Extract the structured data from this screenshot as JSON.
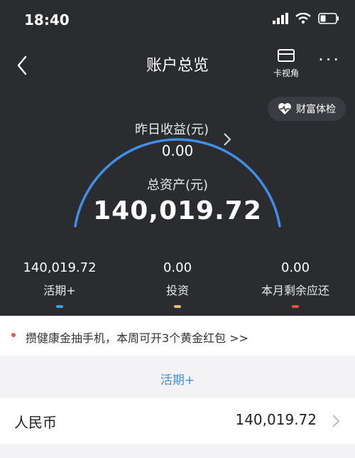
{
  "status": {
    "time": "18:40"
  },
  "nav": {
    "title": "账户总览",
    "card_view_label": "卡视角",
    "more_label": "···"
  },
  "health_check": {
    "label": "财富体检"
  },
  "yesterday_earnings": {
    "label": "昨日收益(元)",
    "value": "0.00"
  },
  "total_assets": {
    "label": "总资产(元)",
    "value": "140,019.72"
  },
  "stats": [
    {
      "value": "140,019.72",
      "label": "活期+",
      "color": "#3aa0e8"
    },
    {
      "value": "0.00",
      "label": "投资",
      "color": "#e3b97f"
    },
    {
      "value": "0.00",
      "label": "本月剩余应还",
      "color": "#e8503a"
    }
  ],
  "promo": {
    "text": "攒健康金抽手机，本周可开3个黄金红包 >>"
  },
  "section": {
    "title": "活期+"
  },
  "currency_row": {
    "label": "人民币",
    "value": "140,019.72"
  },
  "colors": {
    "accent": "#3e8fe6",
    "dark_bg": "#2b2c30"
  }
}
